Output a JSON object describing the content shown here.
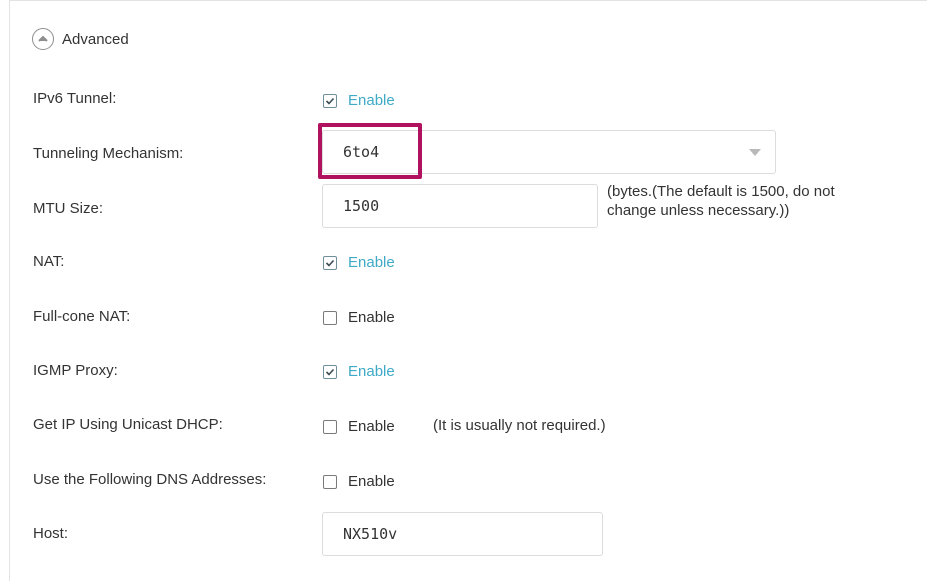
{
  "advanced": {
    "label": "Advanced",
    "icon": "chevron-up-icon"
  },
  "fields": {
    "ipv6_tunnel": {
      "label": "IPv6 Tunnel:",
      "option": "Enable",
      "checked": true
    },
    "tunneling_mechanism": {
      "label": "Tunneling Mechanism:",
      "value": "6to4"
    },
    "mtu_size": {
      "label": "MTU Size:",
      "value": "1500",
      "note_line1": "(bytes.(The default is 1500, do not",
      "note_line2": "change unless necessary.))"
    },
    "nat": {
      "label": "NAT:",
      "option": "Enable",
      "checked": true
    },
    "full_cone_nat": {
      "label": "Full-cone NAT:",
      "option": "Enable",
      "checked": false
    },
    "igmp_proxy": {
      "label": "IGMP Proxy:",
      "option": "Enable",
      "checked": true
    },
    "unicast_dhcp": {
      "label": "Get IP Using Unicast DHCP:",
      "option": "Enable",
      "checked": false,
      "note": "(It is usually not required.)"
    },
    "dns_addresses": {
      "label": "Use the Following DNS Addresses:",
      "option": "Enable",
      "checked": false
    },
    "host": {
      "label": "Host:",
      "value": "NX510v"
    }
  },
  "colors": {
    "accent": "#3eaac6",
    "highlight": "#b1125f",
    "text": "#333333",
    "border": "#dcdcdc"
  }
}
